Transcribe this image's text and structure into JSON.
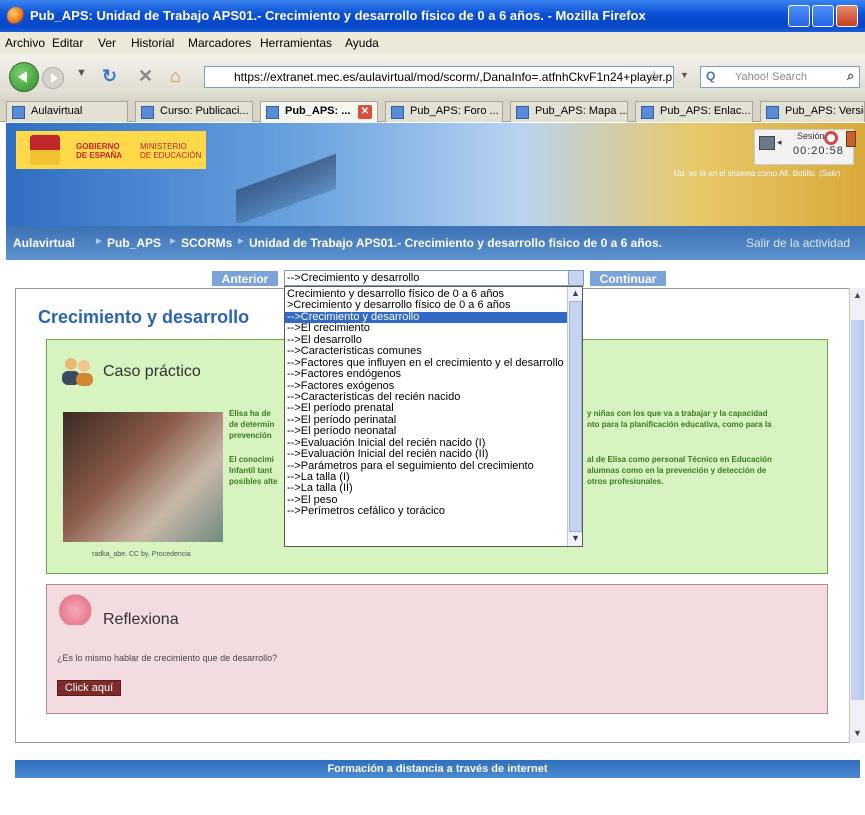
{
  "window": {
    "title": "Pub_APS: Unidad de Trabajo APS01.- Crecimiento y desarrollo físico de 0 a 6 años. - Mozilla Firefox"
  },
  "menu": [
    "Archivo",
    "Editar",
    "Ver",
    "Historial",
    "Marcadores",
    "Herramientas",
    "Ayuda"
  ],
  "toolbar": {
    "url": "https://extranet.mec.es/aulavirtual/mod/scorm/,DanaInfo=.atfnhCkvF1n24+player.p",
    "search_placeholder": "Yahoo! Search"
  },
  "tabs": [
    {
      "label": "Aulavirtual"
    },
    {
      "label": "Curso: Publicaci..."
    },
    {
      "label": "Pub_APS: ..."
    },
    {
      "label": "Pub_APS: Foro ..."
    },
    {
      "label": "Pub_APS: Mapa ..."
    },
    {
      "label": "Pub_APS: Enlac..."
    },
    {
      "label": "Pub_APS: Versió..."
    }
  ],
  "banner": {
    "gov_line1": "GOBIERNO",
    "gov_line2": "DE ESPAÑA",
    "min_line1": "MINISTERIO",
    "min_line2": "DE EDUCACIÓN",
    "session_label": "Sesión",
    "session_time": "00:20:58",
    "user_text": "Ud. es tá en el sistema como Alf. Botillo. (Salir)"
  },
  "breadcrumb": {
    "items": [
      "Aulavirtual",
      "Pub_APS",
      "SCORMs",
      "Unidad de Trabajo APS01.- Crecimiento y desarrollo físico de 0 a 6 años."
    ],
    "exit": "Salir de la actividad"
  },
  "nav": {
    "prev": "Anterior",
    "next": "Continuar",
    "selected": "-->Crecimiento y desarrollo"
  },
  "page": {
    "title": "Crecimiento y desarrollo",
    "caso_heading": "Caso práctico",
    "caso_p1_l1": "Elisa ha de",
    "caso_p1_l2": "de determin",
    "caso_p1_l3": "prevención",
    "caso_p1_r1": "y niñas con los que va a trabajar y la capacidad",
    "caso_p1_r2": "nto para la planificación educativa, como para la",
    "caso_p2_l1": "El conocimi",
    "caso_p2_l2": "Infantil tant",
    "caso_p2_l3": "posibles alte",
    "caso_p2_r1": "al de Elisa como personal Técnico en Educación",
    "caso_p2_r2": "alumnas como en la prevención y detección de",
    "caso_p2_r3": "otros profesionales.",
    "photo_caption": "radka_abe. CC by. Procedencia",
    "refl_heading": "Reflexiona",
    "refl_question": "¿Es lo mismo hablar de crecimiento que de desarrollo?",
    "refl_button": "Click aquí"
  },
  "footer": "Formación a distancia a través de internet",
  "dropdown": {
    "items": [
      "Crecimiento y desarrollo físico de 0 a 6 años",
      ">Crecimiento y desarrollo físico de 0 a 6 años",
      "-->Crecimiento y desarrollo",
      "-->El crecimiento",
      "-->El desarrollo",
      "-->Características comunes",
      "-->Factores que influyen en el crecimiento y el desarrollo",
      "-->Factores endógenos",
      "-->Factores exógenos",
      "-->Características del recién nacido",
      "-->El período prenatal",
      "-->El período perinatal",
      "-->El período neonatal",
      "-->Evaluación Inicial del recién nacido (I)",
      "-->Evaluación Inicial del recién nacido (II)",
      "-->Parámetros para el seguimiento del crecimiento",
      "-->La talla (I)",
      "-->La talla (II)",
      "-->El peso",
      "-->Perímetros cefálico y torácico"
    ],
    "selected_index": 2
  }
}
